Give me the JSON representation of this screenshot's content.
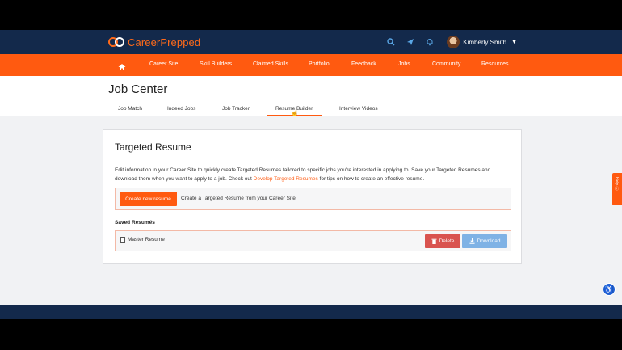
{
  "brand": {
    "name": "CareerPrepped"
  },
  "user": {
    "name": "Kimberly Smith"
  },
  "nav": {
    "items": [
      "Career Site",
      "Skill Builders",
      "Claimed Skills",
      "Portfolio",
      "Feedback",
      "Jobs",
      "Community",
      "Resources"
    ]
  },
  "page": {
    "title": "Job Center",
    "tabs": [
      "Job Match",
      "Indeed Jobs",
      "Job Tracker",
      "Resume Builder",
      "Interview Videos"
    ],
    "active_tab": "Resume Builder"
  },
  "card": {
    "title": "Targeted Resume",
    "desc_part1": "Edit information in your Career Site to quickly create Targeted Resumes tailored to specific jobs you're interested in applying to. Save your Targeted Resumes and download them when you want to apply to a job. Check out ",
    "desc_link": "Develop Targeted Resumes",
    "desc_part2": " for tips on how to create an effective resume.",
    "create_button": "Create new resume",
    "create_text": "Create a Targeted Resume from your Career Site",
    "saved_label": "Saved Resumés",
    "saved": [
      {
        "name": "Master Resume",
        "delete_label": "Delete",
        "download_label": "Download"
      }
    ]
  },
  "feedback_tab": {
    "label": "Help ⓘ"
  },
  "colors": {
    "accent": "#ff5a10",
    "navy": "#13294b",
    "danger": "#d9534f",
    "info": "#7fb2e5"
  },
  "icons": [
    "search-icon",
    "send-icon",
    "bell-icon",
    "home-icon",
    "document-icon",
    "trash-icon",
    "download-icon",
    "accessibility-icon"
  ]
}
